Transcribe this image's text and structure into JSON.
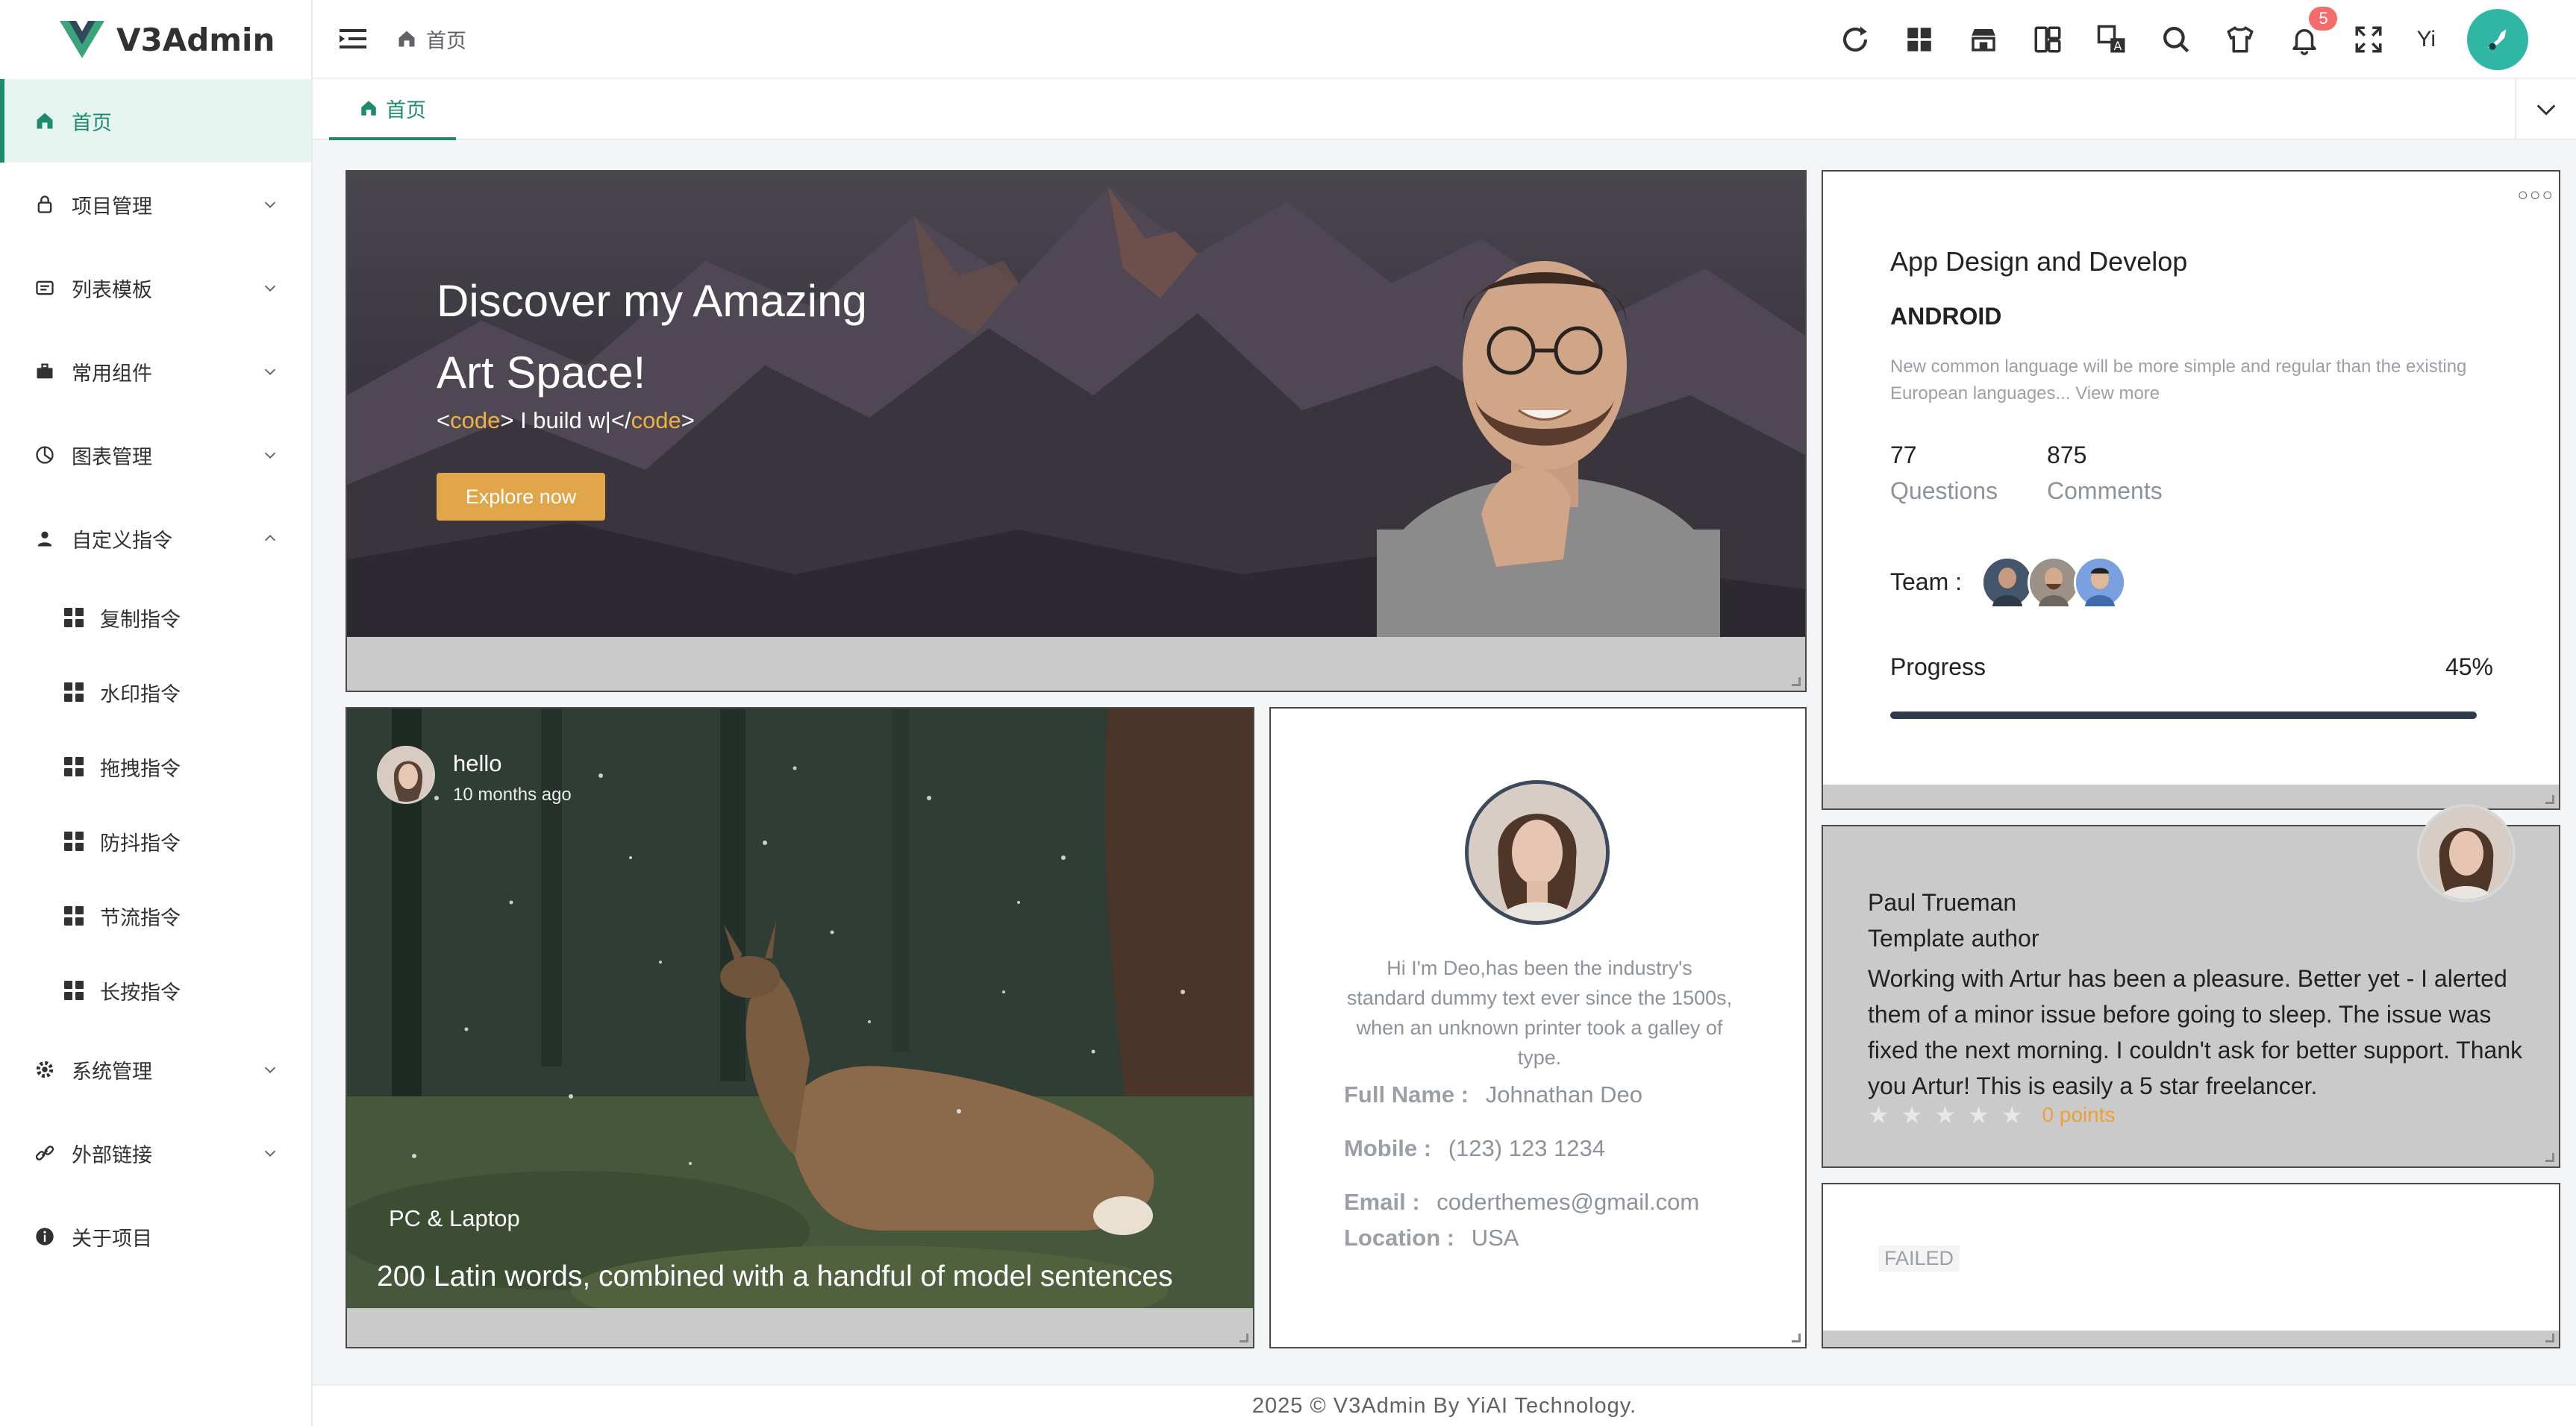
{
  "brand": {
    "name": "V3Admin",
    "color": "#1d8a6e"
  },
  "sidebar": {
    "items": [
      {
        "label": "首页",
        "icon": "home-icon",
        "active": true
      },
      {
        "label": "项目管理",
        "icon": "lock-icon"
      },
      {
        "label": "列表模板",
        "icon": "list-icon"
      },
      {
        "label": "常用组件",
        "icon": "briefcase-icon"
      },
      {
        "label": "图表管理",
        "icon": "chart-icon"
      },
      {
        "label": "自定义指令",
        "icon": "user-icon",
        "expanded": true
      },
      {
        "label": "系统管理",
        "icon": "gear-icon"
      },
      {
        "label": "外部链接",
        "icon": "link-icon"
      },
      {
        "label": "关于项目",
        "icon": "info-icon"
      }
    ],
    "subitems": [
      "复制指令",
      "水印指令",
      "拖拽指令",
      "防抖指令",
      "节流指令",
      "长按指令"
    ]
  },
  "header": {
    "breadcrumb": "首页",
    "notification_count": "5",
    "lang": "Yi",
    "tools": [
      "refresh-icon",
      "apps-icon",
      "store-icon",
      "layout-icon",
      "translate-icon",
      "search-icon",
      "theme-icon",
      "bell-icon",
      "fullscreen-icon"
    ]
  },
  "tabs": {
    "active_tab": "首页"
  },
  "hero": {
    "title_line1": "Discover my Amazing",
    "title_line2": "Art Space!",
    "code_open": "code",
    "code_text": " I build w|</",
    "code_close": "code",
    "button": "Explore now"
  },
  "post": {
    "user": "hello",
    "time": "10 months ago",
    "category": "PC & Laptop",
    "title": "200 Latin words, combined with a handful of model sentences"
  },
  "profile": {
    "description": "Hi I'm Deo,has been the industry's standard dummy text ever since the 1500s, when an unknown printer took a galley of type.",
    "full_name_label": "Full Name :",
    "full_name": "Johnathan Deo",
    "mobile_label": "Mobile :",
    "mobile": "(123) 123 1234",
    "email_label": "Email :",
    "email": "coderthemes@gmail.com",
    "location_label": "Location :",
    "location": "USA"
  },
  "project_card": {
    "title": "App Design and Develop",
    "subtitle": "ANDROID",
    "description": "New common language will be more simple and regular than the existing European languages... View more",
    "questions_value": "77",
    "questions_label": "Questions",
    "comments_value": "875",
    "comments_label": "Comments",
    "team_label": "Team :",
    "progress_label": "Progress",
    "progress_value": "45%",
    "progress": 45
  },
  "testimonial": {
    "name": "Paul Trueman",
    "role": "Template author",
    "text": "Working with Artur has been a pleasure. Better yet - I alerted them of a minor issue before going to sleep. The issue was fixed the next morning. I couldn't ask for better support. Thank you Artur! This is easily a 5 star freelancer.",
    "stars": 0,
    "points": "0 points"
  },
  "failed_card": {
    "text": "FAILED"
  },
  "footer": {
    "text": "2025 © V3Admin By YiAI Technology."
  }
}
